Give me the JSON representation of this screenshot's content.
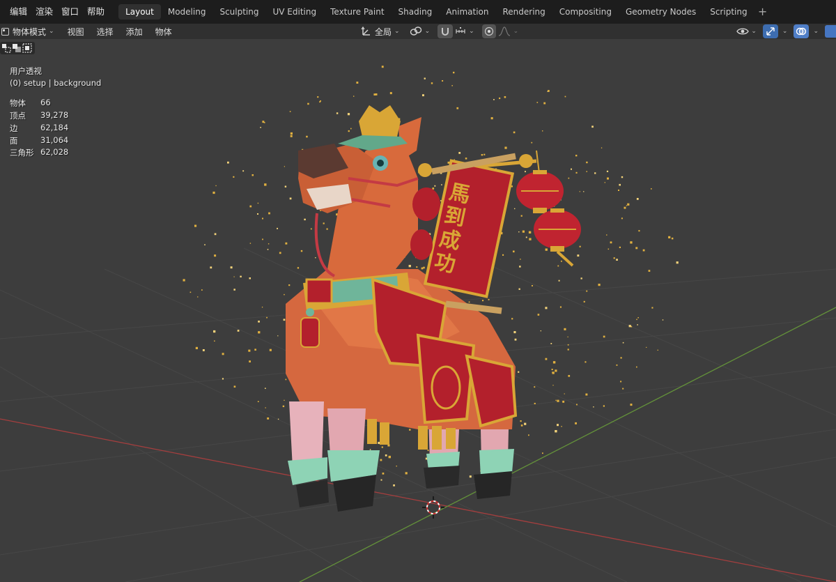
{
  "menu": [
    "编辑",
    "渲染",
    "窗口",
    "帮助"
  ],
  "workspaces": [
    "Layout",
    "Modeling",
    "Sculpting",
    "UV Editing",
    "Texture Paint",
    "Shading",
    "Animation",
    "Rendering",
    "Compositing",
    "Geometry Nodes",
    "Scripting"
  ],
  "active_workspace": "Layout",
  "workspace_add": "+",
  "header": {
    "mode_label": "物体模式",
    "menus": [
      "视图",
      "选择",
      "添加",
      "物体"
    ],
    "transform_orientation": "全局"
  },
  "viewport": {
    "view_name": "用户透视",
    "collection_info": "(0) setup | background",
    "stats": [
      {
        "label": "物体",
        "value": "66"
      },
      {
        "label": "顶点",
        "value": "39,278"
      },
      {
        "label": "边",
        "value": "62,184"
      },
      {
        "label": "面",
        "value": "31,064"
      },
      {
        "label": "三角形",
        "value": "62,028"
      }
    ],
    "scroll_text": "馬到成功"
  },
  "colors": {
    "topbar_bg": "#1d1d1d",
    "header_bg": "#303030",
    "viewport_bg": "#3d3d3d",
    "grid_line": "#4a4a4a",
    "x_axis": "#b04040",
    "y_axis": "#6d9a3c",
    "accent_blue": "#4676c2",
    "horse_orange": "#d86a3c",
    "gold": "#d9a636",
    "red": "#b3202c"
  },
  "icons": [
    "selection-mode-icon",
    "transform-orientation-icon",
    "snap-icon",
    "proportional-edit-icon",
    "visibility-icon",
    "gizmo-icon",
    "overlay-icon",
    "shading-icon"
  ]
}
